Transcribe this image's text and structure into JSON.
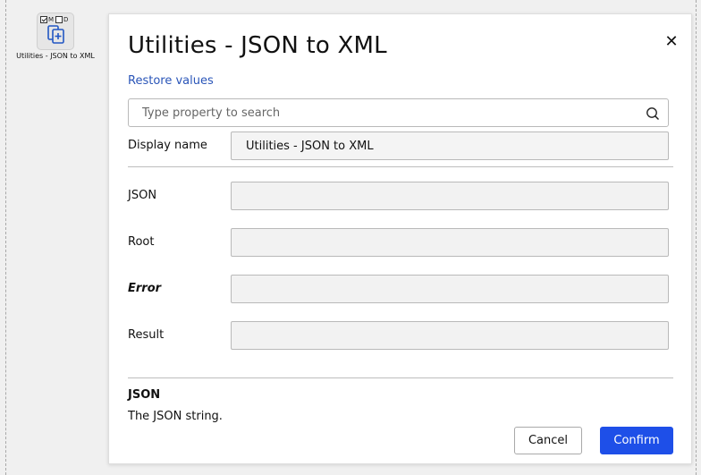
{
  "node": {
    "flag_m": "M",
    "flag_d": "D",
    "flag_m_checked": true,
    "flag_d_checked": false,
    "icon": "copy-plus-icon",
    "label": "Utilities - JSON to XML"
  },
  "dialog": {
    "title": "Utilities - JSON to XML",
    "close_icon": "close-icon",
    "restore_label": "Restore values",
    "search": {
      "placeholder": "Type property to search",
      "value": "",
      "icon": "search-icon"
    },
    "display_name": {
      "label": "Display name",
      "value": "Utilities - JSON to XML"
    },
    "fields": [
      {
        "label": "JSON",
        "value": "",
        "emphasis": false
      },
      {
        "label": "Root",
        "value": "",
        "emphasis": false
      },
      {
        "label": "Error",
        "value": "",
        "emphasis": true
      },
      {
        "label": "Result",
        "value": "",
        "emphasis": false
      }
    ],
    "help": {
      "title": "JSON",
      "text": "The JSON string."
    },
    "buttons": {
      "cancel": "Cancel",
      "confirm": "Confirm"
    }
  },
  "colors": {
    "accent": "#1e4fe8",
    "link": "#2a55b8",
    "field_bg": "#f2f2f2",
    "canvas_bg": "#f0f0f0"
  }
}
